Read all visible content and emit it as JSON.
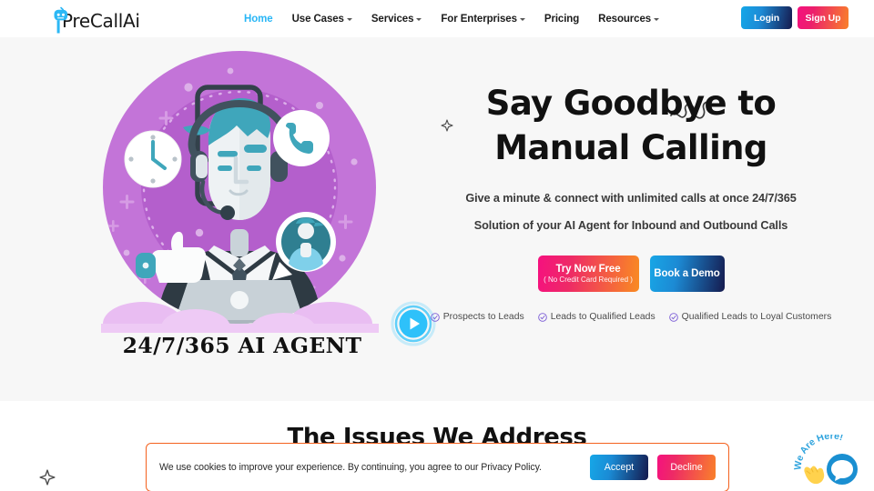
{
  "header": {
    "logo": {
      "text": "PreCallAi",
      "icon": "robot-head-icon"
    },
    "nav": [
      {
        "label": "Home",
        "has_caret": false,
        "active": true
      },
      {
        "label": "Use Cases",
        "has_caret": true,
        "active": false
      },
      {
        "label": "Services",
        "has_caret": true,
        "active": false
      },
      {
        "label": "For Enterprises",
        "has_caret": true,
        "active": false
      },
      {
        "label": "Pricing",
        "has_caret": false,
        "active": false
      },
      {
        "label": "Resources",
        "has_caret": true,
        "active": false
      }
    ],
    "login_label": "Login",
    "signup_label": "Sign Up"
  },
  "hero": {
    "title_line1": "Say Goodbye to",
    "title_line2": "Manual Calling",
    "subtitle1": "Give a minute & connect with unlimited calls at once 24/7/365",
    "subtitle2": "Solution of your AI Agent for Inbound and Outbound Calls",
    "cta_primary": "Try Now Free",
    "cta_primary_note": "( No Credit Card Required )",
    "cta_secondary": "Book a Demo",
    "features": [
      "Prospects to Leads",
      "Leads to Qualified Leads",
      "Qualified Leads to Loyal Customers"
    ],
    "illustration_caption": "24/7/365 AI AGENT",
    "play_button": "play-video-button"
  },
  "section": {
    "issues_title": "The Issues We Address"
  },
  "cookie_banner": {
    "text": "We use  cookies to improve your experience. By continuing, you agree to our Privacy Policy.",
    "accept_label": "Accept",
    "decline_label": "Decline"
  },
  "chat_widget": {
    "label": "We Are Here!",
    "icon": "chat-bubble-icon"
  },
  "colors": {
    "accent_cyan": "#29b6f6",
    "brand_pink": "#f5117f",
    "brand_orange": "#f9812a",
    "brand_navy": "#151a4e",
    "hero_bg": "#f7f7f7",
    "illustration_purple": "#c06fd4",
    "feature_check": "#7b5cd6",
    "cookie_border": "#f4611e"
  }
}
